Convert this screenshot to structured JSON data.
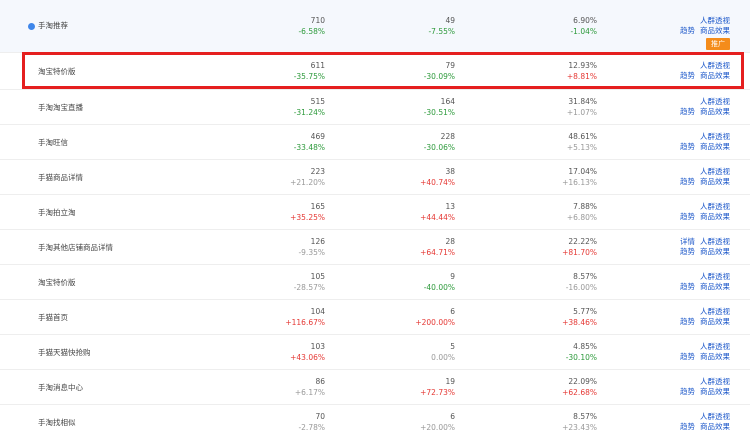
{
  "rows": [
    {
      "name": "手淘推荐",
      "c1v": "710",
      "c1c": "-6.58%",
      "c1t": "neg",
      "c2v": "49",
      "c2c": "-7.55%",
      "c2t": "neg",
      "c3v": "6.90%",
      "c3c": "-1.04%",
      "c3t": "neg",
      "a1": "人群透视",
      "a2": "趋势",
      "a3": "商品效果",
      "detail": "",
      "tag": "推广"
    },
    {
      "name": "淘宝特价版",
      "c1v": "611",
      "c1c": "-35.75%",
      "c1t": "neg",
      "c2v": "79",
      "c2c": "-30.09%",
      "c2t": "neg",
      "c3v": "12.93%",
      "c3c": "+8.81%",
      "c3t": "pos",
      "a1": "人群透视",
      "a2": "趋势",
      "a3": "商品效果",
      "detail": "",
      "tag": ""
    },
    {
      "name": "手淘淘宝直播",
      "c1v": "515",
      "c1c": "-31.24%",
      "c1t": "neg",
      "c2v": "164",
      "c2c": "-30.51%",
      "c2t": "neg",
      "c3v": "31.84%",
      "c3c": "+1.07%",
      "c3t": "neutral",
      "a1": "人群透视",
      "a2": "趋势",
      "a3": "商品效果",
      "detail": "",
      "tag": ""
    },
    {
      "name": "手淘旺信",
      "c1v": "469",
      "c1c": "-33.48%",
      "c1t": "neg",
      "c2v": "228",
      "c2c": "-30.06%",
      "c2t": "neg",
      "c3v": "48.61%",
      "c3c": "+5.13%",
      "c3t": "neutral",
      "a1": "人群透视",
      "a2": "趋势",
      "a3": "商品效果",
      "detail": "",
      "tag": ""
    },
    {
      "name": "手猫商品详情",
      "c1v": "223",
      "c1c": "+21.20%",
      "c1t": "neutral",
      "c2v": "38",
      "c2c": "+40.74%",
      "c2t": "pos",
      "c3v": "17.04%",
      "c3c": "+16.13%",
      "c3t": "neutral",
      "a1": "人群透视",
      "a2": "趋势",
      "a3": "商品效果",
      "detail": "",
      "tag": ""
    },
    {
      "name": "手淘拍立淘",
      "c1v": "165",
      "c1c": "+35.25%",
      "c1t": "pos",
      "c2v": "13",
      "c2c": "+44.44%",
      "c2t": "pos",
      "c3v": "7.88%",
      "c3c": "+6.80%",
      "c3t": "neutral",
      "a1": "人群透视",
      "a2": "趋势",
      "a3": "商品效果",
      "detail": "",
      "tag": ""
    },
    {
      "name": "手淘其他店铺商品详情",
      "c1v": "126",
      "c1c": "-9.35%",
      "c1t": "neutral",
      "c2v": "28",
      "c2c": "+64.71%",
      "c2t": "pos",
      "c3v": "22.22%",
      "c3c": "+81.70%",
      "c3t": "pos",
      "a1": "人群透视",
      "a2": "趋势",
      "a3": "商品效果",
      "detail": "详情",
      "tag": ""
    },
    {
      "name": "淘宝特价版",
      "c1v": "105",
      "c1c": "-28.57%",
      "c1t": "neutral",
      "c2v": "9",
      "c2c": "-40.00%",
      "c2t": "neg",
      "c3v": "8.57%",
      "c3c": "-16.00%",
      "c3t": "neutral",
      "a1": "人群透视",
      "a2": "趋势",
      "a3": "商品效果",
      "detail": "",
      "tag": ""
    },
    {
      "name": "手猫首页",
      "c1v": "104",
      "c1c": "+116.67%",
      "c1t": "pos",
      "c2v": "6",
      "c2c": "+200.00%",
      "c2t": "pos",
      "c3v": "5.77%",
      "c3c": "+38.46%",
      "c3t": "pos",
      "a1": "人群透视",
      "a2": "趋势",
      "a3": "商品效果",
      "detail": "",
      "tag": ""
    },
    {
      "name": "手猫天猫快抢购",
      "c1v": "103",
      "c1c": "+43.06%",
      "c1t": "pos",
      "c2v": "5",
      "c2c": "0.00%",
      "c2t": "neutral",
      "c3v": "4.85%",
      "c3c": "-30.10%",
      "c3t": "neg",
      "a1": "人群透视",
      "a2": "趋势",
      "a3": "商品效果",
      "detail": "",
      "tag": ""
    },
    {
      "name": "手淘消息中心",
      "c1v": "86",
      "c1c": "+6.17%",
      "c1t": "neutral",
      "c2v": "19",
      "c2c": "+72.73%",
      "c2t": "pos",
      "c3v": "22.09%",
      "c3c": "+62.68%",
      "c3t": "pos",
      "a1": "人群透视",
      "a2": "趋势",
      "a3": "商品效果",
      "detail": "",
      "tag": ""
    },
    {
      "name": "手淘找相似",
      "c1v": "70",
      "c1c": "-2.78%",
      "c1t": "neutral",
      "c2v": "6",
      "c2c": "+20.00%",
      "c2t": "neutral",
      "c3v": "8.57%",
      "c3c": "+23.43%",
      "c3t": "neutral",
      "a1": "人群透视",
      "a2": "趋势",
      "a3": "商品效果",
      "detail": "",
      "tag": ""
    }
  ],
  "colors": {
    "accent": "#1a56c9",
    "positive": "#e53935",
    "negative": "#2e9a3c",
    "highlight": "#e51f1f",
    "tag": "#f48c1b"
  }
}
